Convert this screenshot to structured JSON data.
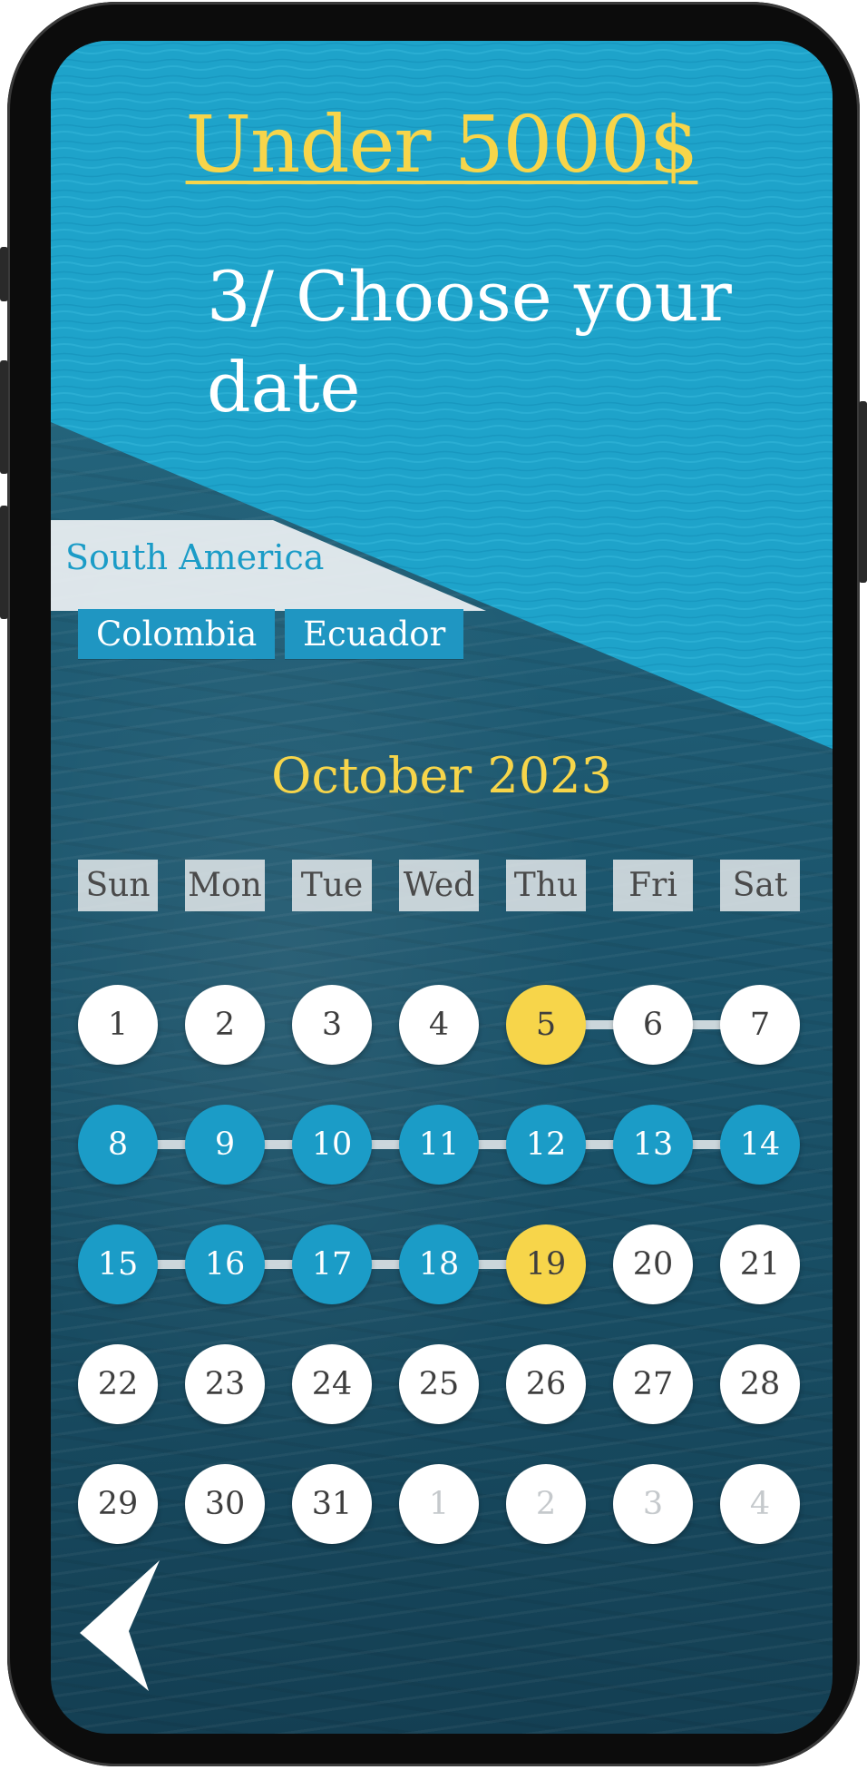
{
  "header": {
    "budget_title": "Under 5000$",
    "step_title": "3/ Choose your date"
  },
  "destination": {
    "region": "South America",
    "countries": [
      "Colombia",
      "Ecuador"
    ]
  },
  "calendar": {
    "month_label": "October 2023",
    "weekdays": [
      "Sun",
      "Mon",
      "Tue",
      "Wed",
      "Thu",
      "Fri",
      "Sat"
    ],
    "weeks": [
      [
        {
          "label": "1",
          "state": "normal"
        },
        {
          "label": "2",
          "state": "normal"
        },
        {
          "label": "3",
          "state": "normal"
        },
        {
          "label": "4",
          "state": "normal"
        },
        {
          "label": "5",
          "state": "endpoint"
        },
        {
          "label": "6",
          "state": "normal"
        },
        {
          "label": "7",
          "state": "normal"
        }
      ],
      [
        {
          "label": "8",
          "state": "range"
        },
        {
          "label": "9",
          "state": "range"
        },
        {
          "label": "10",
          "state": "range"
        },
        {
          "label": "11",
          "state": "range"
        },
        {
          "label": "12",
          "state": "range"
        },
        {
          "label": "13",
          "state": "range"
        },
        {
          "label": "14",
          "state": "range"
        }
      ],
      [
        {
          "label": "15",
          "state": "range"
        },
        {
          "label": "16",
          "state": "range"
        },
        {
          "label": "17",
          "state": "range"
        },
        {
          "label": "18",
          "state": "range"
        },
        {
          "label": "19",
          "state": "endpoint"
        },
        {
          "label": "20",
          "state": "normal"
        },
        {
          "label": "21",
          "state": "normal"
        }
      ],
      [
        {
          "label": "22",
          "state": "normal"
        },
        {
          "label": "23",
          "state": "normal"
        },
        {
          "label": "24",
          "state": "normal"
        },
        {
          "label": "25",
          "state": "normal"
        },
        {
          "label": "26",
          "state": "normal"
        },
        {
          "label": "27",
          "state": "normal"
        },
        {
          "label": "28",
          "state": "normal"
        }
      ],
      [
        {
          "label": "29",
          "state": "normal"
        },
        {
          "label": "30",
          "state": "normal"
        },
        {
          "label": "31",
          "state": "normal"
        },
        {
          "label": "1",
          "state": "other"
        },
        {
          "label": "2",
          "state": "other"
        },
        {
          "label": "3",
          "state": "other"
        },
        {
          "label": "4",
          "state": "other"
        }
      ]
    ],
    "selected_start": "5",
    "selected_end": "19"
  },
  "navigation": {
    "back_icon": "chevron-left-icon"
  },
  "colors": {
    "accent_yellow": "#f7d54a",
    "accent_blue": "#1b9cc7",
    "sea_dark": "#1e5a72"
  }
}
